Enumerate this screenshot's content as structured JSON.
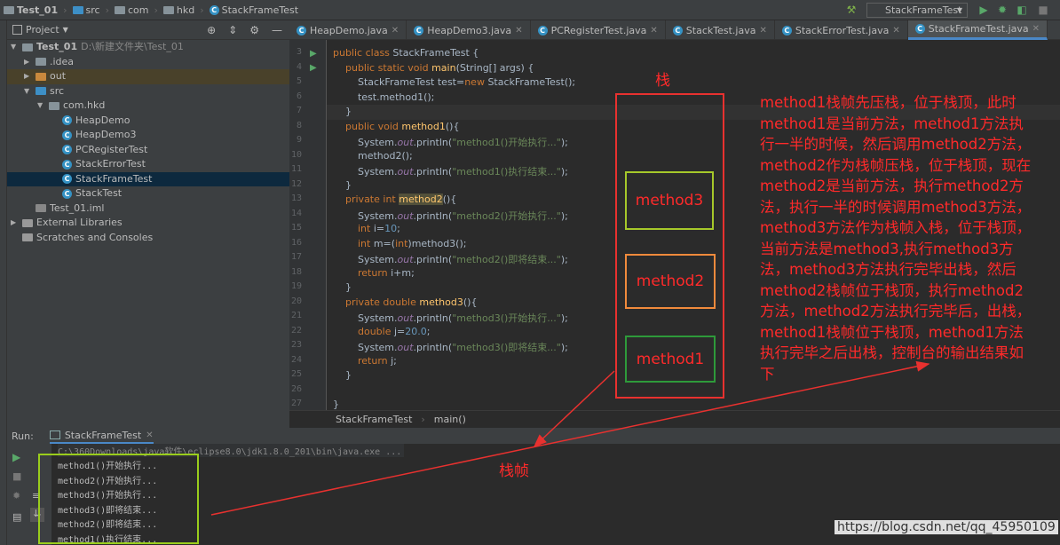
{
  "breadcrumb": [
    "Test_01",
    "src",
    "com",
    "hkd",
    "StackFrameTest"
  ],
  "toolbar": {
    "run_config": "StackFrameTest",
    "icons": [
      "hammer-icon",
      "run-icon",
      "debug-icon",
      "coverage-icon",
      "stop-icon"
    ]
  },
  "project": {
    "title": "Project",
    "tree": [
      {
        "label": "Test_01",
        "extra": "D:\\新建文件夹\\Test_01",
        "depth": 0,
        "icon": "folder",
        "open": true
      },
      {
        "label": ".idea",
        "depth": 1,
        "icon": "folder",
        "open": false
      },
      {
        "label": "out",
        "depth": 1,
        "icon": "folder-orange",
        "open": false,
        "hl": true
      },
      {
        "label": "src",
        "depth": 1,
        "icon": "folder-blue",
        "open": true
      },
      {
        "label": "com.hkd",
        "depth": 2,
        "icon": "package",
        "open": true
      },
      {
        "label": "HeapDemo",
        "depth": 3,
        "icon": "class"
      },
      {
        "label": "HeapDemo3",
        "depth": 3,
        "icon": "class"
      },
      {
        "label": "PCRegisterTest",
        "depth": 3,
        "icon": "class"
      },
      {
        "label": "StackErrorTest",
        "depth": 3,
        "icon": "class"
      },
      {
        "label": "StackFrameTest",
        "depth": 3,
        "icon": "class",
        "selected": true
      },
      {
        "label": "StackTest",
        "depth": 3,
        "icon": "class"
      },
      {
        "label": "Test_01.iml",
        "depth": 1,
        "icon": "file"
      },
      {
        "label": "External Libraries",
        "depth": 0,
        "icon": "lib",
        "open": false
      },
      {
        "label": "Scratches and Consoles",
        "depth": 0,
        "icon": "scratch"
      }
    ]
  },
  "tabs": [
    {
      "label": "HeapDemo.java"
    },
    {
      "label": "HeapDemo3.java"
    },
    {
      "label": "PCRegisterTest.java"
    },
    {
      "label": "StackTest.java"
    },
    {
      "label": "StackErrorTest.java"
    },
    {
      "label": "StackFrameTest.java",
      "active": true
    }
  ],
  "code": [
    [
      3,
      [
        [
          "kw",
          "public class "
        ],
        [
          "",
          "StackFrameTest {"
        ]
      ]
    ],
    [
      4,
      [
        [
          "",
          "    "
        ],
        [
          "kw",
          "public static void "
        ],
        [
          "fn",
          "main"
        ],
        [
          "",
          "(String[] args) {"
        ]
      ]
    ],
    [
      5,
      [
        [
          "",
          "        StackFrameTest test="
        ],
        [
          "kw",
          "new "
        ],
        [
          "",
          "StackFrameTest();"
        ]
      ]
    ],
    [
      6,
      [
        [
          "",
          "        test.method1();"
        ]
      ]
    ],
    [
      7,
      [
        [
          "",
          "    }"
        ]
      ]
    ],
    [
      8,
      [
        [
          "",
          "    "
        ],
        [
          "kw",
          "public void "
        ],
        [
          "fn",
          "method1"
        ],
        [
          "",
          "(){"
        ]
      ]
    ],
    [
      9,
      [
        [
          "",
          "        System."
        ],
        [
          "fld",
          "out"
        ],
        [
          "",
          ".println("
        ],
        [
          "str",
          "\"method1()开始执行...\""
        ],
        [
          "",
          ");"
        ]
      ]
    ],
    [
      10,
      [
        [
          "",
          "        method2();"
        ]
      ]
    ],
    [
      11,
      [
        [
          "",
          "        System."
        ],
        [
          "fld",
          "out"
        ],
        [
          "",
          ".println("
        ],
        [
          "str",
          "\"method1()执行结束...\""
        ],
        [
          "",
          ");"
        ]
      ]
    ],
    [
      12,
      [
        [
          "",
          "    }"
        ]
      ]
    ],
    [
      13,
      [
        [
          "",
          "    "
        ],
        [
          "kw",
          "private int "
        ],
        [
          "fn mark",
          "method2"
        ],
        [
          "",
          "(){"
        ]
      ]
    ],
    [
      14,
      [
        [
          "",
          "        System."
        ],
        [
          "fld",
          "out"
        ],
        [
          "",
          ".println("
        ],
        [
          "str",
          "\"method2()开始执行...\""
        ],
        [
          "",
          ");"
        ]
      ]
    ],
    [
      15,
      [
        [
          "",
          "        "
        ],
        [
          "kw",
          "int "
        ],
        [
          "",
          "i="
        ],
        [
          "num",
          "10"
        ],
        [
          "",
          ";"
        ]
      ]
    ],
    [
      16,
      [
        [
          "",
          "        "
        ],
        [
          "kw",
          "int "
        ],
        [
          "",
          "m=("
        ],
        [
          "kw",
          "int"
        ],
        [
          "",
          ")method3();"
        ]
      ]
    ],
    [
      17,
      [
        [
          "",
          "        System."
        ],
        [
          "fld",
          "out"
        ],
        [
          "",
          ".println("
        ],
        [
          "str",
          "\"method2()即将结束...\""
        ],
        [
          "",
          ");"
        ]
      ]
    ],
    [
      18,
      [
        [
          "",
          "        "
        ],
        [
          "kw",
          "return "
        ],
        [
          "",
          "i+m;"
        ]
      ]
    ],
    [
      19,
      [
        [
          "",
          "    }"
        ]
      ]
    ],
    [
      20,
      [
        [
          "",
          "    "
        ],
        [
          "kw",
          "private double "
        ],
        [
          "fn",
          "method3"
        ],
        [
          "",
          "(){"
        ]
      ]
    ],
    [
      21,
      [
        [
          "",
          "        System."
        ],
        [
          "fld",
          "out"
        ],
        [
          "",
          ".println("
        ],
        [
          "str",
          "\"method3()开始执行...\""
        ],
        [
          "",
          ");"
        ]
      ]
    ],
    [
      22,
      [
        [
          "",
          "        "
        ],
        [
          "kw",
          "double "
        ],
        [
          "",
          "j="
        ],
        [
          "num",
          "20.0"
        ],
        [
          "",
          ";"
        ]
      ]
    ],
    [
      23,
      [
        [
          "",
          "        System."
        ],
        [
          "fld",
          "out"
        ],
        [
          "",
          ".println("
        ],
        [
          "str",
          "\"method3()即将结束...\""
        ],
        [
          "",
          ");"
        ]
      ]
    ],
    [
      24,
      [
        [
          "",
          "        "
        ],
        [
          "kw",
          "return "
        ],
        [
          "",
          "j;"
        ]
      ]
    ],
    [
      25,
      [
        [
          "",
          "    }"
        ]
      ]
    ],
    [
      26,
      [
        [
          "",
          ""
        ]
      ]
    ],
    [
      27,
      [
        [
          "",
          "}"
        ]
      ]
    ]
  ],
  "editor_breadcrumb": [
    "StackFrameTest",
    "main()"
  ],
  "run": {
    "label": "Run:",
    "tab": "StackFrameTest",
    "command": "C:\\360Downloads\\java软件\\eclipse8.0\\jdk1.8.0_201\\bin\\java.exe ...",
    "output": [
      "method1()开始执行...",
      "method2()开始执行...",
      "method3()开始执行...",
      "method3()即将结束...",
      "method2()即将结束...",
      "method1()执行结束..."
    ]
  },
  "annotation": {
    "stack_label": "栈",
    "frame_label": "栈帧",
    "frames": [
      "method3",
      "method2",
      "method1"
    ],
    "frame_colors": [
      "#a6c82a",
      "#f08a3c",
      "#2e9a3a"
    ],
    "explanation": [
      "method1栈帧先压栈，位于栈顶，此时",
      "method1是当前方法，method1方法执",
      "行一半的时候，然后调用method2方法，",
      "method2作为栈帧压栈，位于栈顶，现在",
      "method2是当前方法，执行method2方",
      "法，执行一半的时候调用method3方法，",
      "method3方法作为栈帧入栈，位于栈顶，",
      "当前方法是method3,执行method3方",
      "法，method3方法执行完毕出栈，然后",
      "method2栈帧位于栈顶，执行method2",
      "方法，method2方法执行完毕后，出栈，",
      "method1栈帧位于栈顶，method1方法",
      "执行完毕之后出栈，控制台的输出结果如",
      "下"
    ]
  },
  "watermark": "https://blog.csdn.net/qq_45950109"
}
